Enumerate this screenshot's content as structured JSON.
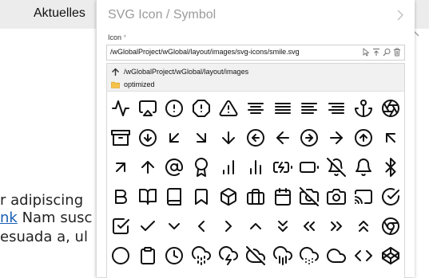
{
  "menu": {
    "label": "Aktuelles"
  },
  "background_text": {
    "line1": "r adipiscing",
    "line2_link": "nk",
    "line2_rest": " Nam susc",
    "line3": "esuada a, ul"
  },
  "panel": {
    "title": "SVG Icon / Symbol",
    "icon_label": "Icon",
    "icon_required": "*",
    "path_value": "/wGlobalProject/wGlobal/layout/images/svg-icons/smile.svg",
    "field_icons": [
      "cursor-arrow-icon",
      "upload-icon",
      "search-icon",
      "trash-icon"
    ]
  },
  "browser": {
    "up_path": "/wGlobalProject/wGlobal/layout/images",
    "folder_name": "optimized",
    "icons": [
      [
        "activity-icon",
        "airplay-icon",
        "alert-circle-icon",
        "alert-octagon-icon",
        "alert-triangle-icon",
        "align-center-icon",
        "align-justify-icon",
        "align-left-icon",
        "align-right-icon",
        "anchor-icon",
        "aperture-icon"
      ],
      [
        "archive-icon",
        "arrow-down-circle-icon",
        "arrow-down-left-icon",
        "arrow-down-right-icon",
        "arrow-down-icon",
        "arrow-left-circle-icon",
        "arrow-left-icon",
        "arrow-right-circle-icon",
        "arrow-right-icon",
        "arrow-up-circle-icon",
        "arrow-up-left-icon"
      ],
      [
        "arrow-up-right-icon",
        "arrow-up-icon",
        "at-sign-icon",
        "award-icon",
        "bar-chart-icon",
        "bar-chart-2-icon",
        "battery-charging-icon",
        "battery-icon",
        "bell-off-icon",
        "bell-icon",
        "bluetooth-icon"
      ],
      [
        "bold-icon",
        "book-open-icon",
        "book-icon",
        "bookmark-icon",
        "box-icon",
        "briefcase-icon",
        "calendar-icon",
        "camera-off-icon",
        "camera-icon",
        "cast-icon",
        "check-circle-icon"
      ],
      [
        "check-square-icon",
        "check-icon",
        "chevron-down-icon",
        "chevron-left-icon",
        "chevron-right-icon",
        "chevron-up-icon",
        "chevrons-down-icon",
        "chevrons-left-icon",
        "chevrons-right-icon",
        "chevrons-up-icon",
        "chrome-icon"
      ],
      [
        "circle-icon",
        "clipboard-icon",
        "clock-icon",
        "cloud-drizzle-icon",
        "cloud-lightning-icon",
        "cloud-off-icon",
        "cloud-rain-icon",
        "cloud-snow-icon",
        "cloud-icon",
        "code-icon",
        "codepen-icon"
      ]
    ]
  }
}
